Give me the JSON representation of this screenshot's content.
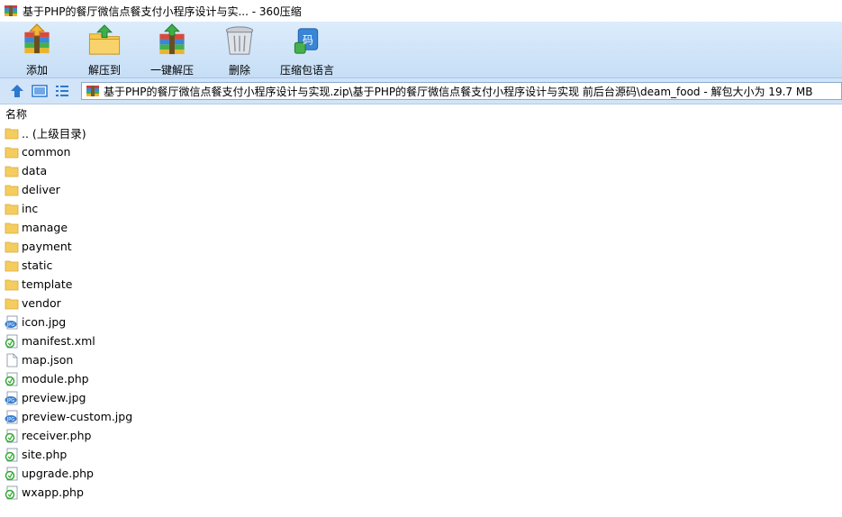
{
  "window": {
    "title": "基于PHP的餐厅微信点餐支付小程序设计与实... - 360压缩"
  },
  "toolbar": {
    "buttons": [
      {
        "id": "add",
        "label": "添加",
        "icon": "add-archive-icon"
      },
      {
        "id": "extract",
        "label": "解压到",
        "icon": "extract-to-icon"
      },
      {
        "id": "oneclick",
        "label": "一键解压",
        "icon": "one-click-extract-icon"
      },
      {
        "id": "delete",
        "label": "删除",
        "icon": "trash-icon"
      },
      {
        "id": "encoding",
        "label": "压缩包语言",
        "icon": "encoding-icon"
      }
    ]
  },
  "address": {
    "path": "基于PHP的餐厅微信点餐支付小程序设计与实现.zip\\基于PHP的餐厅微信点餐支付小程序设计与实现 前后台源码\\deam_food - 解包大小为 19.7 MB"
  },
  "list": {
    "column_name": "名称",
    "items": [
      {
        "name": ".. (上级目录)",
        "type": "folder"
      },
      {
        "name": "common",
        "type": "folder"
      },
      {
        "name": "data",
        "type": "folder"
      },
      {
        "name": "deliver",
        "type": "folder"
      },
      {
        "name": "inc",
        "type": "folder"
      },
      {
        "name": "manage",
        "type": "folder"
      },
      {
        "name": "payment",
        "type": "folder"
      },
      {
        "name": "static",
        "type": "folder"
      },
      {
        "name": "template",
        "type": "folder"
      },
      {
        "name": "vendor",
        "type": "folder"
      },
      {
        "name": "icon.jpg",
        "type": "jpg"
      },
      {
        "name": "manifest.xml",
        "type": "script"
      },
      {
        "name": "map.json",
        "type": "file"
      },
      {
        "name": "module.php",
        "type": "script"
      },
      {
        "name": "preview.jpg",
        "type": "jpg"
      },
      {
        "name": "preview-custom.jpg",
        "type": "jpg"
      },
      {
        "name": "receiver.php",
        "type": "script"
      },
      {
        "name": "site.php",
        "type": "script"
      },
      {
        "name": "upgrade.php",
        "type": "script"
      },
      {
        "name": "wxapp.php",
        "type": "script"
      }
    ]
  },
  "colors": {
    "toolbar_bg": "#c6def6",
    "folder": "#f5cd5e",
    "jpg_badge": "#3a7fd0",
    "script_green": "#2aa52a"
  }
}
